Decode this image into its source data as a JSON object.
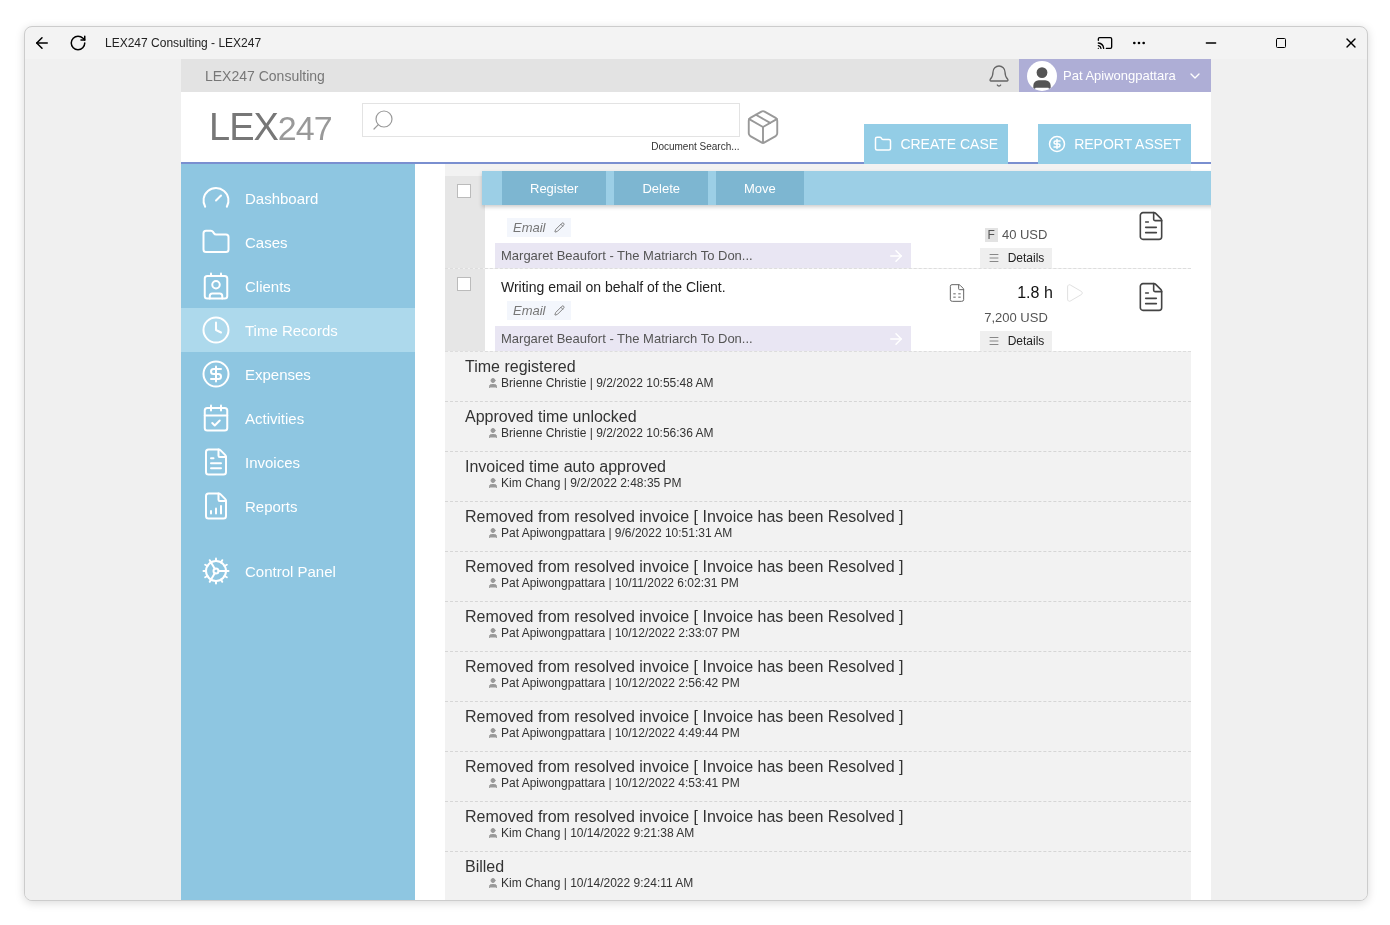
{
  "window": {
    "title": "LEX247 Consulting - LEX247"
  },
  "top_bar": {
    "company": "LEX247 Consulting",
    "user": "Pat Apiwongpattara"
  },
  "header": {
    "logo_main": "LEX",
    "logo_num": "247",
    "search_caption": "Document Search...",
    "buttons": [
      {
        "label": "CREATE CASE",
        "kind": "folder"
      },
      {
        "label": "REPORT ASSET",
        "kind": "dollar"
      }
    ]
  },
  "sidebar": {
    "items": [
      {
        "label": "Dashboard",
        "kind": "gauge",
        "selected": false
      },
      {
        "label": "Cases",
        "kind": "folder",
        "selected": false
      },
      {
        "label": "Clients",
        "kind": "contact",
        "selected": false
      },
      {
        "label": "Time Records",
        "kind": "clock",
        "selected": true
      },
      {
        "label": "Expenses",
        "kind": "dollar",
        "selected": false
      },
      {
        "label": "Activities",
        "kind": "calendar",
        "selected": false
      },
      {
        "label": "Invoices",
        "kind": "invoice",
        "selected": false
      },
      {
        "label": "Reports",
        "kind": "report",
        "selected": false
      }
    ],
    "footer_items": [
      {
        "label": "Control Panel",
        "kind": "gears",
        "selected": false
      }
    ]
  },
  "action_bar": {
    "buttons": [
      {
        "label": "Register",
        "disabled": true
      },
      {
        "label": "Delete",
        "disabled": true
      },
      {
        "label": "Move",
        "disabled": true
      }
    ]
  },
  "records": [
    {
      "checked": false,
      "tag": "Email",
      "fixed": "F",
      "amount": "40 USD",
      "matter": "Margaret Beaufort - The Matriarch To Don...",
      "details": "Details"
    },
    {
      "checked": false,
      "description": "Writing email on behalf of the Client.",
      "hours": "1.8 h",
      "tag": "Email",
      "amount": "7,200 USD",
      "matter": "Margaret Beaufort - The Matriarch To Don...",
      "details": "Details"
    }
  ],
  "history": [
    {
      "event": "Time registered",
      "meta": "Brienne Christie | 9/2/2022 10:55:48 AM"
    },
    {
      "event": "Approved time unlocked",
      "meta": "Brienne Christie | 9/2/2022 10:56:36 AM"
    },
    {
      "event": "Invoiced time auto approved",
      "meta": "Kim Chang | 9/2/2022 2:48:35 PM"
    },
    {
      "event": "Removed from resolved invoice [ Invoice has been Resolved ]",
      "meta": "Pat Apiwongpattara | 9/6/2022 10:51:31 AM"
    },
    {
      "event": "Removed from resolved invoice [ Invoice has been Resolved ]",
      "meta": "Pat Apiwongpattara | 10/11/2022 6:02:31 PM"
    },
    {
      "event": "Removed from resolved invoice [ Invoice has been Resolved ]",
      "meta": "Pat Apiwongpattara | 10/12/2022 2:33:07 PM"
    },
    {
      "event": "Removed from resolved invoice [ Invoice has been Resolved ]",
      "meta": "Pat Apiwongpattara | 10/12/2022 2:56:42 PM"
    },
    {
      "event": "Removed from resolved invoice [ Invoice has been Resolved ]",
      "meta": "Pat Apiwongpattara | 10/12/2022 4:49:44 PM"
    },
    {
      "event": "Removed from resolved invoice [ Invoice has been Resolved ]",
      "meta": "Pat Apiwongpattara | 10/12/2022 4:53:41 PM"
    },
    {
      "event": "Removed from resolved invoice [ Invoice has been Resolved ]",
      "meta": "Kim Chang | 10/14/2022 9:21:38 AM"
    },
    {
      "event": "Billed",
      "meta": "Kim Chang | 10/14/2022 9:24:11 AM"
    }
  ]
}
